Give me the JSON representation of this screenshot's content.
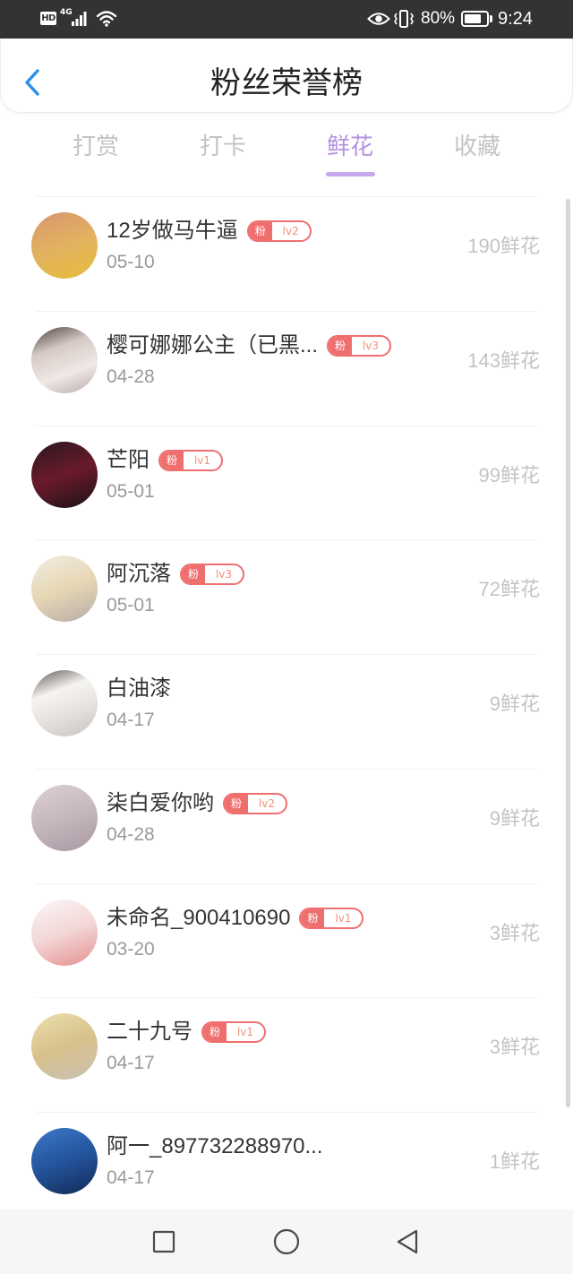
{
  "status_bar": {
    "hd_label": "HD",
    "network_label": "4G",
    "battery_text": "80%",
    "battery_level": 0.8,
    "time": "9:24",
    "icons": [
      "signal-icon",
      "wifi-icon",
      "eye-icon",
      "vibrate-icon",
      "battery-icon"
    ]
  },
  "header": {
    "title": "粉丝荣誉榜",
    "back_icon": "chevron-left-icon"
  },
  "tabs": [
    {
      "label": "打赏",
      "active": false
    },
    {
      "label": "打卡",
      "active": false
    },
    {
      "label": "鲜花",
      "active": true
    },
    {
      "label": "收藏",
      "active": false
    }
  ],
  "fans": [
    {
      "name": "12岁做马牛逼",
      "badge": {
        "prefix": "粉",
        "level": "lv2"
      },
      "date": "05-10",
      "count": "190鲜花",
      "avatar_colors": [
        "#d8956e",
        "#e2b260",
        "#e6bd3a"
      ]
    },
    {
      "name": "樱可娜娜公主（已黑...",
      "badge": {
        "prefix": "粉",
        "level": "lv3"
      },
      "date": "04-28",
      "count": "143鲜花",
      "avatar_colors": [
        "#4a3d3b",
        "#d6cac6",
        "#efe8e5",
        "#b9aba8"
      ]
    },
    {
      "name": "芒阳",
      "badge": {
        "prefix": "粉",
        "level": "lv1"
      },
      "date": "05-01",
      "count": "99鲜花",
      "avatar_colors": [
        "#2a1820",
        "#6a1a2a",
        "#1a1218"
      ]
    },
    {
      "name": "阿沉落",
      "badge": {
        "prefix": "粉",
        "level": "lv3"
      },
      "date": "05-01",
      "count": "72鲜花",
      "avatar_colors": [
        "#f2ece2",
        "#e6d7b4",
        "#b8aca8"
      ]
    },
    {
      "name": "白油漆",
      "date": "04-17",
      "count": "9鲜花",
      "avatar_colors": [
        "#5a5450",
        "#f6f4f2",
        "#e2dedb",
        "#c9c4c0"
      ]
    },
    {
      "name": "柒白爱你哟",
      "badge": {
        "prefix": "粉",
        "level": "lv2"
      },
      "date": "04-28",
      "count": "9鲜花",
      "avatar_colors": [
        "#ddd0d6",
        "#c6b6be",
        "#a89aa2"
      ]
    },
    {
      "name": "未命名_900410690",
      "badge": {
        "prefix": "粉",
        "level": "lv1"
      },
      "date": "03-20",
      "count": "3鲜花",
      "avatar_colors": [
        "#fbf7f7",
        "#f3d6d6",
        "#e58f8f"
      ]
    },
    {
      "name": "二十九号",
      "badge": {
        "prefix": "粉",
        "level": "lv1"
      },
      "date": "04-17",
      "count": "3鲜花",
      "avatar_colors": [
        "#ece0b0",
        "#d7c08a",
        "#c9c2b6"
      ]
    },
    {
      "name": "阿一_897732288970...",
      "date": "04-17",
      "count": "1鲜花",
      "avatar_colors": [
        "#3d78c8",
        "#24549c",
        "#122a55"
      ]
    }
  ],
  "nav_bar": {
    "icons": [
      "recents-square-icon",
      "home-circle-icon",
      "back-triangle-icon"
    ]
  },
  "theme": {
    "status_bar_bg": "#333333",
    "status_bar_fg": "#ffffff",
    "back_icon": "#2b8fe8",
    "active_tab": "#b590e3",
    "tab_indicator": "#c7a8ee",
    "inactive_tab": "#c3c3c3",
    "name_text": "#333333",
    "date_text": "#9a9a9a",
    "count_text": "#c4c4c4",
    "badge": "#ef6f6f",
    "badge_level_text": "#f0907a",
    "scrollbar": "#d6d6d6",
    "nav_bar_bg": "#f6f6f6",
    "nav_icon": "#4a4a4a"
  }
}
